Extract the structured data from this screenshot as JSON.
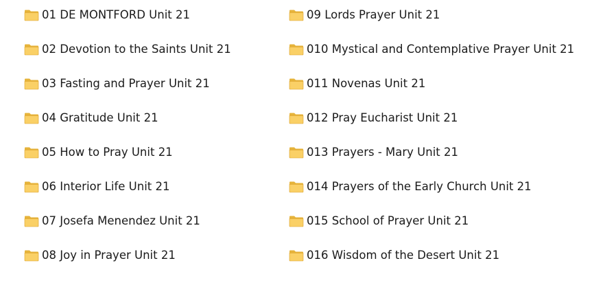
{
  "icon": "folder-icon",
  "colors": {
    "folder_back": "#E6B33A",
    "folder_front": "#FAD066",
    "folder_edge": "#D9A02A",
    "text": "#1a1a1a"
  },
  "columns": [
    {
      "items": [
        {
          "label": "01 DE MONTFORD Unit 21"
        },
        {
          "label": "02 Devotion to the Saints Unit 21"
        },
        {
          "label": "03 Fasting and Prayer Unit 21"
        },
        {
          "label": "04 Gratitude Unit 21"
        },
        {
          "label": "05 How to Pray Unit 21"
        },
        {
          "label": "06 Interior Life Unit 21"
        },
        {
          "label": "07 Josefa Menendez Unit 21"
        },
        {
          "label": "08 Joy in Prayer Unit 21"
        }
      ]
    },
    {
      "items": [
        {
          "label": "09 Lords Prayer Unit 21"
        },
        {
          "label": "010 Mystical and Contemplative Prayer Unit 21"
        },
        {
          "label": "011 Novenas Unit 21"
        },
        {
          "label": "012 Pray Eucharist Unit 21"
        },
        {
          "label": "013 Prayers - Mary Unit 21"
        },
        {
          "label": "014 Prayers of the Early Church Unit 21"
        },
        {
          "label": "015 School of Prayer Unit 21"
        },
        {
          "label": "016 Wisdom of the Desert Unit 21"
        }
      ]
    }
  ]
}
